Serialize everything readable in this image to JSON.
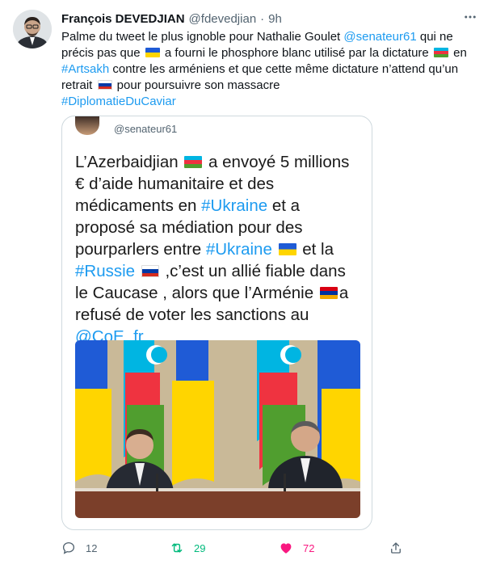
{
  "author": {
    "name": "François DEVEDJIAN",
    "handle": "@fdevedjian",
    "separator": "·",
    "time": "9h",
    "more_icon": "more-icon"
  },
  "tweet": {
    "t1": "Palme du tweet le plus ignoble pour Nathalie Goulet ",
    "mention": "@senateur61",
    "t2": " qui ne précis pas que ",
    "t3": " a fourni le phosphore blanc utilisé par la dictature ",
    "t4": " en ",
    "hashtag1": "#Artsakh",
    "t5": " contre les arméniens et que cette même dictature n’attend qu’un retrait ",
    "t6": " pour poursuivre son massacre",
    "hashtag2": "#DiplomatieDuCaviar"
  },
  "quoted": {
    "handle": "@senateur61",
    "q1": "L’Azerbaidjian ",
    "q2": " a envoyé 5 millions € d’aide humanitaire et des médicaments en ",
    "ukraine": "#Ukraine",
    "q3": " et a proposé sa médiation pour des pourparlers entre ",
    "q4": " et la ",
    "russie": "#Russie",
    "q5": " ,c’est un allié fiable dans le Caucase , alors que l’Arménie ",
    "q6": "a refusé de voter les sanctions au ",
    "coe": "@CoE_fr"
  },
  "actions": {
    "reply_count": "12",
    "retweet_count": "29",
    "like_count": "72"
  },
  "colors": {
    "link": "#1d9bf0",
    "retweet": "#00ba7c",
    "like": "#f91880",
    "muted": "#536471"
  }
}
